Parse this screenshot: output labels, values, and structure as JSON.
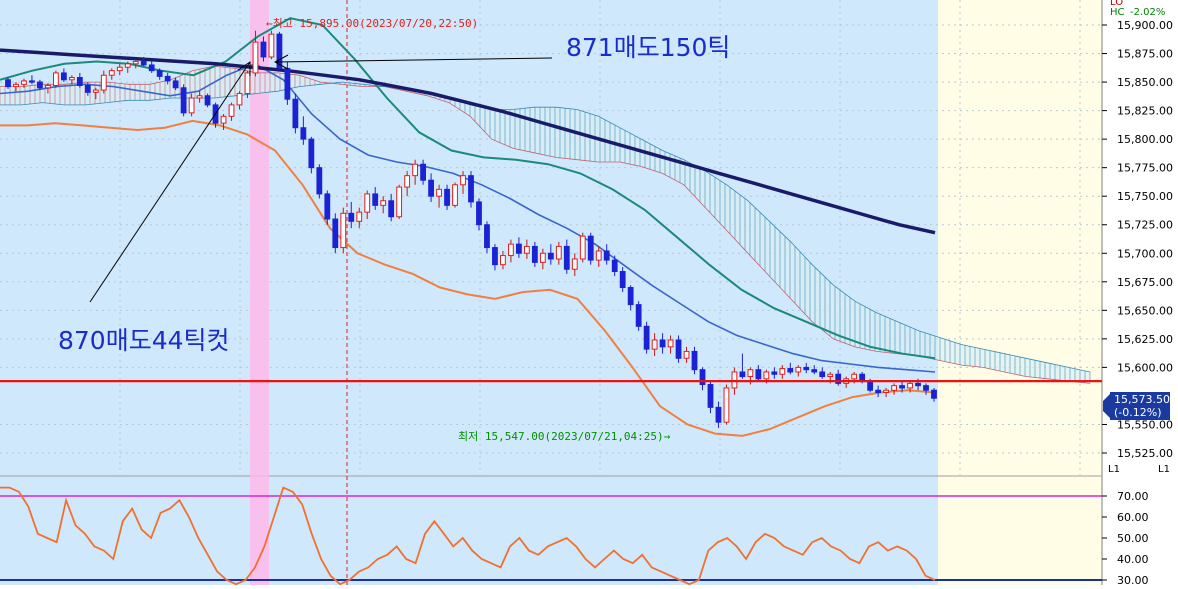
{
  "chart_data": {
    "type": "candlestick",
    "y_axis": {
      "ticks": [
        "15,900.00",
        "15,875.00",
        "15,850.00",
        "15,825.00",
        "15,800.00",
        "15,775.00",
        "15,750.00",
        "15,725.00",
        "15,700.00",
        "15,675.00",
        "15,650.00",
        "15,625.00",
        "15,600.00",
        "15,550.00",
        "15,525.00"
      ],
      "ylim": [
        15515,
        15915
      ]
    },
    "osc_axis": {
      "ticks": [
        "70.00",
        "60.00",
        "50.00",
        "40.00",
        "30.00"
      ],
      "ylim": [
        28,
        78
      ]
    },
    "corner_labels": {
      "lo": "LO",
      "hc": "HC",
      "hc_value": "-2.02%",
      "small_1": "L1",
      "small_2": "L1"
    },
    "current_price": {
      "value": "15,573.50",
      "change": "(-0.12%)"
    },
    "high_marker": {
      "text": "←최고 15,895.00(2023/07/20,22:50)",
      "price": 15895
    },
    "low_marker": {
      "text": "최저 15,547.00(2023/07/21,04:25)→",
      "price": 15547
    },
    "annotations": [
      {
        "text": "871매도150틱"
      },
      {
        "text": "870매도44틱컷"
      }
    ],
    "reference_lines": {
      "support_price": 15588,
      "osc_upper": 70,
      "osc_lower": 30
    },
    "candles": [
      [
        15852,
        15854,
        15844,
        15846
      ],
      [
        15846,
        15850,
        15842,
        15848
      ],
      [
        15848,
        15853,
        15845,
        15851
      ],
      [
        15851,
        15856,
        15848,
        15850
      ],
      [
        15850,
        15852,
        15843,
        15845
      ],
      [
        15845,
        15849,
        15840,
        15847
      ],
      [
        15847,
        15860,
        15845,
        15858
      ],
      [
        15858,
        15862,
        15850,
        15852
      ],
      [
        15852,
        15856,
        15848,
        15854
      ],
      [
        15854,
        15858,
        15845,
        15847
      ],
      [
        15847,
        15850,
        15838,
        15841
      ],
      [
        15841,
        15845,
        15835,
        15843
      ],
      [
        15843,
        15860,
        15840,
        15856
      ],
      [
        15856,
        15862,
        15852,
        15860
      ],
      [
        15860,
        15866,
        15856,
        15863
      ],
      [
        15863,
        15868,
        15858,
        15866
      ],
      [
        15866,
        15870,
        15862,
        15868
      ],
      [
        15868,
        15872,
        15864,
        15865
      ],
      [
        15865,
        15868,
        15858,
        15860
      ],
      [
        15860,
        15862,
        15852,
        15855
      ],
      [
        15855,
        15858,
        15848,
        15851
      ],
      [
        15851,
        15854,
        15843,
        15845
      ],
      [
        15845,
        15848,
        15820,
        15823
      ],
      [
        15823,
        15840,
        15820,
        15836
      ],
      [
        15836,
        15842,
        15832,
        15838
      ],
      [
        15838,
        15840,
        15828,
        15830
      ],
      [
        15830,
        15832,
        15810,
        15814
      ],
      [
        15814,
        15822,
        15808,
        15820
      ],
      [
        15820,
        15832,
        15816,
        15830
      ],
      [
        15830,
        15842,
        15826,
        15840
      ],
      [
        15840,
        15860,
        15836,
        15858
      ],
      [
        15858,
        15895,
        15855,
        15885
      ],
      [
        15885,
        15890,
        15868,
        15872
      ],
      [
        15872,
        15895,
        15870,
        15892
      ],
      [
        15892,
        15894,
        15868,
        15862
      ],
      [
        15862,
        15868,
        15830,
        15835
      ],
      [
        15835,
        15840,
        15805,
        15810
      ],
      [
        15810,
        15820,
        15795,
        15800
      ],
      [
        15800,
        15802,
        15770,
        15775
      ],
      [
        15775,
        15778,
        15748,
        15752
      ],
      [
        15752,
        15755,
        15725,
        15730
      ],
      [
        15730,
        15735,
        15700,
        15705
      ],
      [
        15705,
        15740,
        15700,
        15735
      ],
      [
        15735,
        15745,
        15722,
        15728
      ],
      [
        15728,
        15740,
        15722,
        15736
      ],
      [
        15736,
        15755,
        15730,
        15752
      ],
      [
        15752,
        15758,
        15738,
        15742
      ],
      [
        15742,
        15750,
        15735,
        15746
      ],
      [
        15746,
        15752,
        15728,
        15732
      ],
      [
        15732,
        15760,
        15730,
        15758
      ],
      [
        15758,
        15772,
        15750,
        15768
      ],
      [
        15768,
        15782,
        15760,
        15778
      ],
      [
        15778,
        15782,
        15760,
        15764
      ],
      [
        15764,
        15770,
        15745,
        15750
      ],
      [
        15750,
        15760,
        15740,
        15756
      ],
      [
        15756,
        15760,
        15738,
        15742
      ],
      [
        15742,
        15762,
        15740,
        15760
      ],
      [
        15760,
        15772,
        15752,
        15768
      ],
      [
        15768,
        15772,
        15740,
        15745
      ],
      [
        15745,
        15748,
        15720,
        15725
      ],
      [
        15725,
        15728,
        15700,
        15705
      ],
      [
        15705,
        15708,
        15685,
        15690
      ],
      [
        15690,
        15702,
        15686,
        15698
      ],
      [
        15698,
        15712,
        15692,
        15708
      ],
      [
        15708,
        15714,
        15696,
        15700
      ],
      [
        15700,
        15712,
        15695,
        15706
      ],
      [
        15706,
        15710,
        15688,
        15692
      ],
      [
        15692,
        15704,
        15686,
        15700
      ],
      [
        15700,
        15708,
        15690,
        15695
      ],
      [
        15695,
        15710,
        15690,
        15706
      ],
      [
        15706,
        15712,
        15682,
        15686
      ],
      [
        15686,
        15700,
        15680,
        15695
      ],
      [
        15695,
        15718,
        15692,
        15715
      ],
      [
        15715,
        15718,
        15690,
        15694
      ],
      [
        15694,
        15706,
        15688,
        15702
      ],
      [
        15702,
        15708,
        15690,
        15694
      ],
      [
        15694,
        15698,
        15680,
        15684
      ],
      [
        15684,
        15688,
        15666,
        15670
      ],
      [
        15670,
        15672,
        15650,
        15655
      ],
      [
        15655,
        15658,
        15632,
        15636
      ],
      [
        15636,
        15640,
        15612,
        15616
      ],
      [
        15616,
        15630,
        15610,
        15624
      ],
      [
        15624,
        15630,
        15612,
        15618
      ],
      [
        15618,
        15628,
        15612,
        15624
      ],
      [
        15624,
        15628,
        15604,
        15608
      ],
      [
        15608,
        15618,
        15604,
        15614
      ],
      [
        15614,
        15618,
        15594,
        15598
      ],
      [
        15598,
        15600,
        15580,
        15585
      ],
      [
        15585,
        15588,
        15560,
        15565
      ],
      [
        15565,
        15570,
        15547,
        15552
      ],
      [
        15552,
        15585,
        15550,
        15582
      ],
      [
        15582,
        15600,
        15576,
        15596
      ],
      [
        15596,
        15612,
        15590,
        15592
      ],
      [
        15592,
        15600,
        15585,
        15598
      ],
      [
        15598,
        15602,
        15588,
        15590
      ],
      [
        15590,
        15598,
        15586,
        15596
      ],
      [
        15596,
        15600,
        15590,
        15594
      ],
      [
        15594,
        15602,
        15590,
        15599
      ],
      [
        15599,
        15604,
        15594,
        15596
      ],
      [
        15596,
        15602,
        15592,
        15600
      ],
      [
        15600,
        15604,
        15595,
        15598
      ],
      [
        15598,
        15602,
        15594,
        15596
      ],
      [
        15596,
        15600,
        15590,
        15592
      ],
      [
        15592,
        15596,
        15586,
        15594
      ],
      [
        15594,
        15598,
        15584,
        15586
      ],
      [
        15586,
        15592,
        15582,
        15590
      ],
      [
        15590,
        15596,
        15586,
        15594
      ],
      [
        15594,
        15596,
        15586,
        15588
      ],
      [
        15588,
        15590,
        15578,
        15580
      ],
      [
        15580,
        15584,
        15574,
        15578
      ],
      [
        15578,
        15582,
        15574,
        15580
      ],
      [
        15580,
        15586,
        15576,
        15584
      ],
      [
        15584,
        15588,
        15578,
        15582
      ],
      [
        15582,
        15588,
        15578,
        15586
      ],
      [
        15586,
        15590,
        15580,
        15584
      ],
      [
        15584,
        15586,
        15576,
        15580
      ],
      [
        15580,
        15582,
        15570,
        15573
      ]
    ],
    "indicators": {
      "ma_long": [
        15878,
        15876,
        15874,
        15872,
        15870,
        15868,
        15866,
        15863,
        15860,
        15856,
        15852,
        15846,
        15840,
        15832,
        15824,
        15815,
        15806,
        15797,
        15788,
        15779,
        15770,
        15761,
        15752,
        15743,
        15734,
        15725,
        15718
      ],
      "ma_mid": [
        15852,
        15860,
        15866,
        15868,
        15866,
        15860,
        15856,
        15868,
        15890,
        15906,
        15900,
        15870,
        15836,
        15806,
        15790,
        15784,
        15782,
        15778,
        15770,
        15756,
        15738,
        15714,
        15690,
        15668,
        15652,
        15640,
        15628,
        15618,
        15612,
        15608
      ],
      "bb_upper": [
        15840,
        15842,
        15846,
        15848,
        15846,
        15842,
        15838,
        15842,
        15856,
        15866,
        15852,
        15822,
        15800,
        15786,
        15780,
        15776,
        15770,
        15760,
        15748,
        15734,
        15722,
        15708,
        15690,
        15672,
        15656,
        15640,
        15628,
        15620,
        15612,
        15606,
        15603,
        15600,
        15598,
        15596
      ],
      "bb_lower": [
        15812,
        15812,
        15814,
        15812,
        15810,
        15808,
        15810,
        15816,
        15812,
        15804,
        15790,
        15760,
        15722,
        15700,
        15690,
        15682,
        15670,
        15664,
        15660,
        15666,
        15668,
        15660,
        15632,
        15600,
        15566,
        15550,
        15542,
        15540,
        15546,
        15556,
        15566,
        15574,
        15578,
        15580,
        15578
      ],
      "cloud_span_a": [
        15846,
        15846,
        15848,
        15848,
        15850,
        15850,
        15848,
        15848,
        15852,
        15860,
        15864,
        15862,
        15858,
        15858,
        15856,
        15850,
        15848,
        15846,
        15846,
        15842,
        15838,
        15832,
        15820,
        15800,
        15792,
        15788,
        15784,
        15782,
        15780,
        15780,
        15776,
        15770,
        15760,
        15740,
        15720,
        15700,
        15680,
        15660,
        15640,
        15625,
        15618,
        15614,
        15612,
        15610,
        15606,
        15602,
        15600,
        15596,
        15592,
        15590,
        15588,
        15586
      ],
      "cloud_span_b": [
        15830,
        15830,
        15832,
        15830,
        15830,
        15832,
        15834,
        15834,
        15836,
        15836,
        15836,
        15838,
        15840,
        15842,
        15846,
        15848,
        15850,
        15848,
        15846,
        15844,
        15840,
        15836,
        15830,
        15826,
        15826,
        15828,
        15828,
        15826,
        15820,
        15810,
        15800,
        15790,
        15782,
        15772,
        15760,
        15746,
        15728,
        15710,
        15690,
        15672,
        15658,
        15648,
        15640,
        15632,
        15626,
        15620,
        15616,
        15612,
        15608,
        15604,
        15600,
        15596
      ]
    },
    "oscillator": [
      74,
      74,
      72,
      65,
      52,
      50,
      48,
      68,
      56,
      52,
      46,
      44,
      40,
      58,
      64,
      54,
      50,
      62,
      64,
      68,
      60,
      50,
      42,
      34,
      30,
      28,
      30,
      36,
      46,
      60,
      74,
      72,
      66,
      52,
      40,
      32,
      28,
      30,
      34,
      36,
      40,
      42,
      46,
      40,
      38,
      52,
      58,
      52,
      46,
      50,
      44,
      40,
      38,
      36,
      46,
      50,
      44,
      42,
      46,
      48,
      50,
      46,
      40,
      36,
      40,
      44,
      40,
      38,
      42,
      36,
      34,
      32,
      30,
      28,
      30,
      44,
      48,
      50,
      46,
      40,
      48,
      52,
      50,
      46,
      44,
      42,
      48,
      50,
      46,
      44,
      40,
      38,
      46,
      48,
      44,
      46,
      44,
      40,
      32,
      30
    ]
  }
}
